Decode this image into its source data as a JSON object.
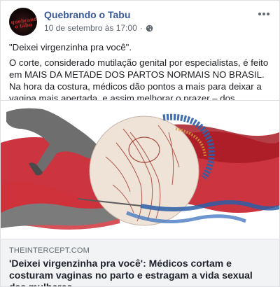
{
  "post": {
    "page_name": "Quebrando o Tabu",
    "timestamp": "10 de setembro às 17:00",
    "separator": "·",
    "privacy_icon": "globe-icon",
    "more_icon": "more-options-icon",
    "avatar_text": "quebrando o tabu",
    "quote": "\"Deixei virgenzinha pra você\".",
    "paragraph": "O corte, considerado mutilação genital por especialistas, é feito em MAIS DA METADE DOS PARTOS NORMAIS NO BRASIL. Na hora da costura, médicos dão pontos a mais para deixar a vagina mais apertada, e assim melhorar o prazer – dos homens, é claro:"
  },
  "link_preview": {
    "domain": "THEINTERCEPT.COM",
    "title": "'Deixei virgenzinha pra você': Médicos cortam e costuram vaginas no parto e estragam a vida sexual das mulheres"
  },
  "colors": {
    "link_blue": "#385898",
    "text": "#1c1e21",
    "meta_gray": "#616770",
    "preview_bg": "#f2f3f5",
    "collage_red": "#c8232f",
    "collage_blue": "#2b5fa8"
  }
}
